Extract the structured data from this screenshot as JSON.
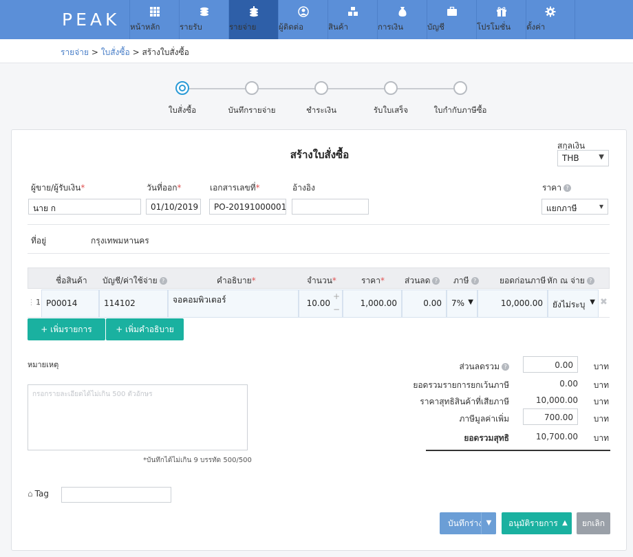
{
  "brand": "PEAK",
  "nav": [
    {
      "label": "หน้าหลัก",
      "icon": "grid-icon"
    },
    {
      "label": "รายรับ",
      "icon": "coins-icon"
    },
    {
      "label": "รายจ่าย",
      "icon": "coins-out-icon"
    },
    {
      "label": "ผู้ติดต่อ",
      "icon": "person-icon"
    },
    {
      "label": "สินค้า",
      "icon": "boxes-icon"
    },
    {
      "label": "การเงิน",
      "icon": "money-bag-icon"
    },
    {
      "label": "บัญชี",
      "icon": "briefcase-icon"
    },
    {
      "label": "โปรโมชั่น",
      "icon": "gift-icon"
    },
    {
      "label": "ตั้งค่า",
      "icon": "gear-icon"
    }
  ],
  "breadcrumb": {
    "l1": "รายจ่าย",
    "sep": ">",
    "l2": "ใบสั่งซื้อ",
    "l3": "สร้างใบสั่งซื้อ"
  },
  "steps": [
    "ใบสั่งซื้อ",
    "บันทึกรายจ่าย",
    "ชำระเงิน",
    "รับใบเสร็จ",
    "ใบกำกับภาษีซื้อ"
  ],
  "form": {
    "title": "สร้างใบสั่งซื้อ",
    "currency_label": "สกุลเงิน",
    "currency_value": "THB",
    "vendor_label": "ผู้ขาย/ผู้รับเงิน",
    "vendor_value": "นาย ก",
    "issue_date_label": "วันที่ออก",
    "issue_date_value": "01/10/2019",
    "doc_no_label": "เอกสารเลขที่",
    "doc_no_value": "PO-20191000001",
    "ref_label": "อ้างอิง",
    "ref_value": "",
    "price_label": "ราคา",
    "price_value": "แยกภาษี",
    "address_label": "ที่อยู่",
    "address_value": "กรุงเทพมหานคร",
    "req_mark": "*"
  },
  "table": {
    "headers": {
      "product": "ชื่อสินค้า",
      "account": "บัญชี/ค่าใช้จ่าย",
      "desc": "คำอธิบาย",
      "qty": "จำนวน",
      "price": "ราคา",
      "discount": "ส่วนลด",
      "tax": "ภาษี",
      "pretax": "ยอดก่อนภาษี",
      "wht": "หัก ณ จ่าย"
    },
    "rows": [
      {
        "no": "1",
        "product": "P00014",
        "account": "114102",
        "desc": "จอคอมพิวเตอร์",
        "qty": "10.00",
        "price": "1,000.00",
        "discount": "0.00",
        "tax": "7%",
        "pretax": "10,000.00",
        "wht": "ยังไม่ระบุ"
      }
    ],
    "add_row_label": "+ เพิ่มรายการ",
    "add_desc_label": "+ เพิ่มคำอธิบาย"
  },
  "notes": {
    "label": "หมายเหตุ",
    "placeholder": "กรอกรายละเอียดได้ไม่เกิน 500 ตัวอักษร",
    "hint": "*บันทึกได้ไม่เกิน 9 บรรทัด 500/500"
  },
  "summary": {
    "unit": "บาท",
    "discount_label": "ส่วนลดรวม",
    "discount_value": "0.00",
    "exempt_label": "ยอดรวมรายการยกเว้นภาษี",
    "exempt_value": "0.00",
    "taxable_label": "ราคาสุทธิสินค้าที่เสียภาษี",
    "taxable_value": "10,000.00",
    "vat_label": "ภาษีมูลค่าเพิ่ม",
    "vat_value": "700.00",
    "total_label": "ยอดรวมสุทธิ",
    "total_value": "10,700.00"
  },
  "tag": {
    "label": "Tag",
    "value": ""
  },
  "actions": {
    "draft": "บันทึกร่าง",
    "approve": "อนุมัติรายการ",
    "cancel": "ยกเลิก"
  },
  "colors": {
    "nav": "#5b8fd8",
    "nav_active": "#2e5fa8",
    "accent": "#1ab1a0",
    "step_active": "#2a9ad6"
  }
}
